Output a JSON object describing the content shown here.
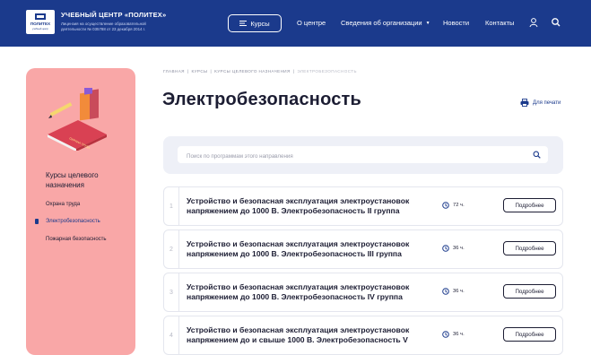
{
  "header": {
    "logo_text": "ПОЛИТЕХ",
    "logo_subtext": "учебный центр",
    "title": "УЧЕБНЫЙ ЦЕНТР «ПОЛИТЕХ»",
    "license": "Лицензия на осуществление образовательной деятельности № 035788 от 23 декабря 2014 г.",
    "courses_button": "Курсы",
    "nav": [
      "О центре",
      "Сведения об организации",
      "Новости",
      "Контакты"
    ],
    "colors": {
      "background": "#1b3a8c",
      "text": "#ffffff"
    }
  },
  "sidebar": {
    "illustration_label": "ОХРАНА ТРУДА",
    "title": "Курсы целевого назначения",
    "items": [
      {
        "label": "Охрана труда",
        "active": false
      },
      {
        "label": "Электробезопасность",
        "active": true
      },
      {
        "label": "Пожарная безопасность",
        "active": false
      }
    ],
    "colors": {
      "background": "#f9a7a7",
      "active": "#1b3a8c"
    }
  },
  "breadcrumb": [
    "Главная",
    "Курсы",
    "Курсы целевого назначения",
    "Электробезопасность"
  ],
  "page_title": "Электробезопасность",
  "print_label": "Для печати",
  "search": {
    "placeholder": "Поиск по программам этого направления",
    "value": ""
  },
  "courses": [
    {
      "number": "1",
      "title": "Устройство и безопасная эксплуатация электроустановок напряжением до 1000 В. Электробезопасность II группа",
      "duration": "72 ч.",
      "button": "Подробнее"
    },
    {
      "number": "2",
      "title": "Устройство и безопасная эксплуатация электроустановок напряжением до 1000 В. Электробезопасность III группа",
      "duration": "36 ч.",
      "button": "Подробнее"
    },
    {
      "number": "3",
      "title": "Устройство и безопасная эксплуатация электроустановок напряжением до 1000 В. Электробезопасность IV группа",
      "duration": "36 ч.",
      "button": "Подробнее"
    },
    {
      "number": "4",
      "title": "Устройство и безопасная эксплуатация электроустановок напряжением до и свыше 1000 В. Электробезопасность V",
      "duration": "36 ч.",
      "button": "Подробнее"
    }
  ]
}
